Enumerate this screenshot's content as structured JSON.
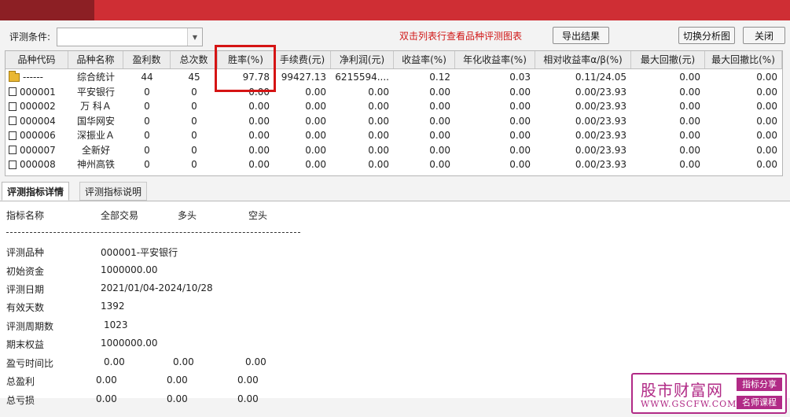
{
  "toolbar": {
    "condition_label": "评测条件:",
    "condition_value": "",
    "hint": "双击列表行查看品种评测图表",
    "export_btn": "导出结果",
    "switch_btn": "切换分析图",
    "close_btn": "关闭"
  },
  "table": {
    "headers": [
      "品种代码",
      "品种名称",
      "盈利数",
      "总次数",
      "胜率(%)",
      "手续费(元)",
      "净利润(元)",
      "收益率(%)",
      "年化收益率(%)",
      "相对收益率α/β(%)",
      "最大回撤(元)",
      "最大回撤比(%)"
    ],
    "rows": [
      {
        "code": "------",
        "name": "综合统计",
        "win": "44",
        "total": "45",
        "rate": "97.78",
        "fee": "99427.13",
        "profit": "6215594....",
        "ret": "0.12",
        "annual": "0.03",
        "rel": "0.11/24.05",
        "dd": "0.00",
        "ddr": "0.00",
        "icon": "folder-icon"
      },
      {
        "code": "000001",
        "name": "平安银行",
        "win": "0",
        "total": "0",
        "rate": "0.00",
        "fee": "0.00",
        "profit": "0.00",
        "ret": "0.00",
        "annual": "0.00",
        "rel": "0.00/23.93",
        "dd": "0.00",
        "ddr": "0.00",
        "icon": "file-icon"
      },
      {
        "code": "000002",
        "name": "万 科Ａ",
        "win": "0",
        "total": "0",
        "rate": "0.00",
        "fee": "0.00",
        "profit": "0.00",
        "ret": "0.00",
        "annual": "0.00",
        "rel": "0.00/23.93",
        "dd": "0.00",
        "ddr": "0.00",
        "icon": "file-icon"
      },
      {
        "code": "000004",
        "name": "国华网安",
        "win": "0",
        "total": "0",
        "rate": "0.00",
        "fee": "0.00",
        "profit": "0.00",
        "ret": "0.00",
        "annual": "0.00",
        "rel": "0.00/23.93",
        "dd": "0.00",
        "ddr": "0.00",
        "icon": "file-icon"
      },
      {
        "code": "000006",
        "name": "深振业Ａ",
        "win": "0",
        "total": "0",
        "rate": "0.00",
        "fee": "0.00",
        "profit": "0.00",
        "ret": "0.00",
        "annual": "0.00",
        "rel": "0.00/23.93",
        "dd": "0.00",
        "ddr": "0.00",
        "icon": "file-icon"
      },
      {
        "code": "000007",
        "name": "全新好",
        "win": "0",
        "total": "0",
        "rate": "0.00",
        "fee": "0.00",
        "profit": "0.00",
        "ret": "0.00",
        "annual": "0.00",
        "rel": "0.00/23.93",
        "dd": "0.00",
        "ddr": "0.00",
        "icon": "file-icon"
      },
      {
        "code": "000008",
        "name": "神州高铁",
        "win": "0",
        "total": "0",
        "rate": "0.00",
        "fee": "0.00",
        "profit": "0.00",
        "ret": "0.00",
        "annual": "0.00",
        "rel": "0.00/23.93",
        "dd": "0.00",
        "ddr": "0.00",
        "icon": "file-icon"
      }
    ]
  },
  "tabs": [
    "评测指标详情",
    "评测指标说明"
  ],
  "detail": {
    "headers": [
      "指标名称",
      "全部交易",
      "多头",
      "空头"
    ],
    "rows": [
      {
        "label": "评测品种",
        "v1": "000001-平安银行",
        "v2": "",
        "v3": ""
      },
      {
        "label": "初始资金",
        "v1": "1000000.00",
        "v2": "",
        "v3": ""
      },
      {
        "label": "评测日期",
        "v1": "2021/01/04-2024/10/28",
        "v2": "",
        "v3": ""
      },
      {
        "label": "有效天数",
        "v1": "1392",
        "v2": "",
        "v3": ""
      },
      {
        "label": "评测周期数",
        "v1": "1023",
        "v2": "",
        "v3": ""
      },
      {
        "label": "期末权益",
        "v1": "1000000.00",
        "v2": "",
        "v3": ""
      },
      {
        "label": "盈亏时间比",
        "v1": "0.00",
        "v2": "0.00",
        "v3": "0.00"
      },
      {
        "label": "总盈利",
        "v1": "0.00",
        "v2": "0.00",
        "v3": "0.00"
      },
      {
        "label": "总亏损",
        "v1": "0.00",
        "v2": "0.00",
        "v3": "0.00"
      }
    ]
  },
  "watermark": {
    "title": "股市财富网",
    "url": "WWW.GSCFW.COM",
    "tag1": "指标分享",
    "tag2": "名师课程"
  },
  "colors": {
    "title_bar": "#cf2e34",
    "hint_text": "#d01818",
    "highlight_box": "#d51414",
    "watermark": "#b12a86"
  }
}
